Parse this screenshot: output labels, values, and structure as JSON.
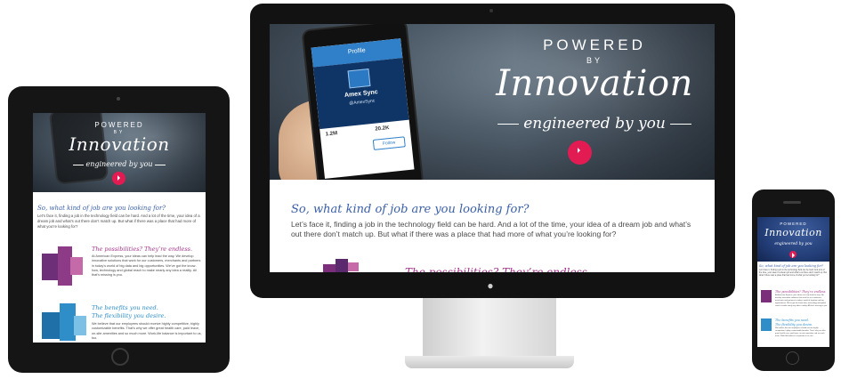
{
  "hero": {
    "powered": "POWERED",
    "by": "BY",
    "innovation": "Innovation",
    "engineered": "engineered by you"
  },
  "phone_mock": {
    "header": "Profile",
    "name": "Amex Sync",
    "handle": "@AmexSync",
    "stat1": "1.2M",
    "stat2": "20.2K",
    "follow": "Follow"
  },
  "content": {
    "heading": "So, what kind of job are you looking for?",
    "intro": "Let’s face it, finding a job in the technology field can be hard. And a lot of the time, your idea of a dream job and what’s out there don’t match up. But what if there was a place that had more of what you’re looking for?",
    "possibilities_title": "The possibilities? They’re endless.",
    "possibilities_body": "At American Express, your ideas can help lead the way. We develop innovative solutions that work for our customers, merchants and partners in today’s world of big data and big opportunities. We’ve got the know-how, technology and global reach to make nearly any idea a reality. All that’s missing is you.",
    "benefits_title_1": "The benefits you need.",
    "benefits_title_2": "The flexibility you desire.",
    "benefits_body": "We believe that our employees should receive highly competitive, highly customizable benefits. That’s why we offer great health care, paid leave, on-site amenities and so much more. Work-life balance is important to us, too."
  },
  "colors": {
    "heading_blue": "#3a5fa8",
    "accent_pink": "#a3358a",
    "accent_blue": "#2f8ec8",
    "play_red": "#e31b53"
  }
}
